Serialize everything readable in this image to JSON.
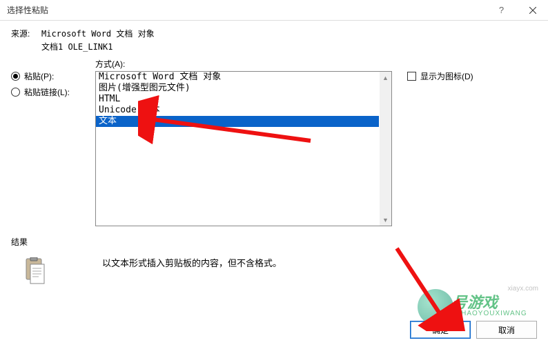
{
  "dialog": {
    "title": "选择性粘贴",
    "source_label": "来源:",
    "source_line1": "Microsoft Word 文档 对象",
    "source_line2": "文档1 OLE_LINK1",
    "format_label": "方式(A):",
    "radio_paste": "粘贴(P):",
    "radio_paste_link": "粘贴链接(L):",
    "list_items": [
      "Microsoft Word 文档 对象",
      "图片(增强型图元文件)",
      "HTML",
      "Unicode 文本",
      "文本"
    ],
    "selected_index": 4,
    "show_as_icon": "显示为图标(D)",
    "result_label": "结果",
    "result_desc": "以文本形式插入剪贴板的内容，但不含格式。",
    "ok_btn": "确定",
    "cancel_btn": "取消"
  },
  "watermark": {
    "brand": "号游戏",
    "pinyin": "ZHAOYOUXIWANG",
    "extra": "xiayx.com"
  }
}
